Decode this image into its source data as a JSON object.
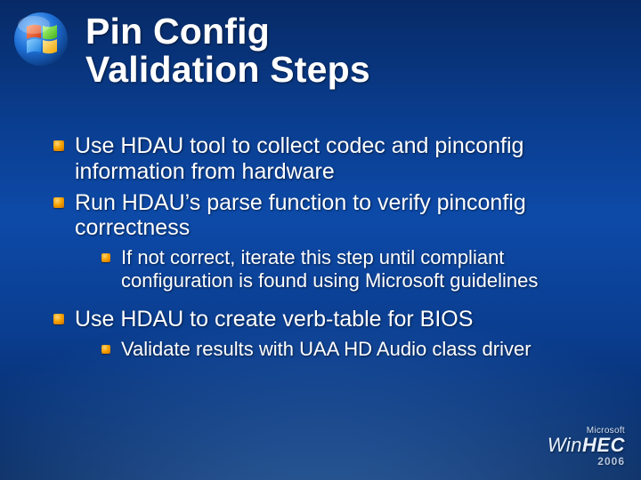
{
  "title_line1": "Pin Config",
  "title_line2": "Validation Steps",
  "bullets": {
    "b0": "Use HDAU tool to collect codec and pinconfig information from hardware",
    "b1": "Run HDAU’s parse function to verify pinconfig correctness",
    "b1_sub0": "If not correct, iterate this step until compliant configuration is found using Microsoft guidelines",
    "b2": "Use HDAU to create verb-table for BIOS",
    "b2_sub0": "Validate results with UAA HD Audio class driver"
  },
  "footer": {
    "company": "Microsoft",
    "brand_prefix": "Win",
    "brand_suffix": "HEC",
    "year": "2006"
  }
}
